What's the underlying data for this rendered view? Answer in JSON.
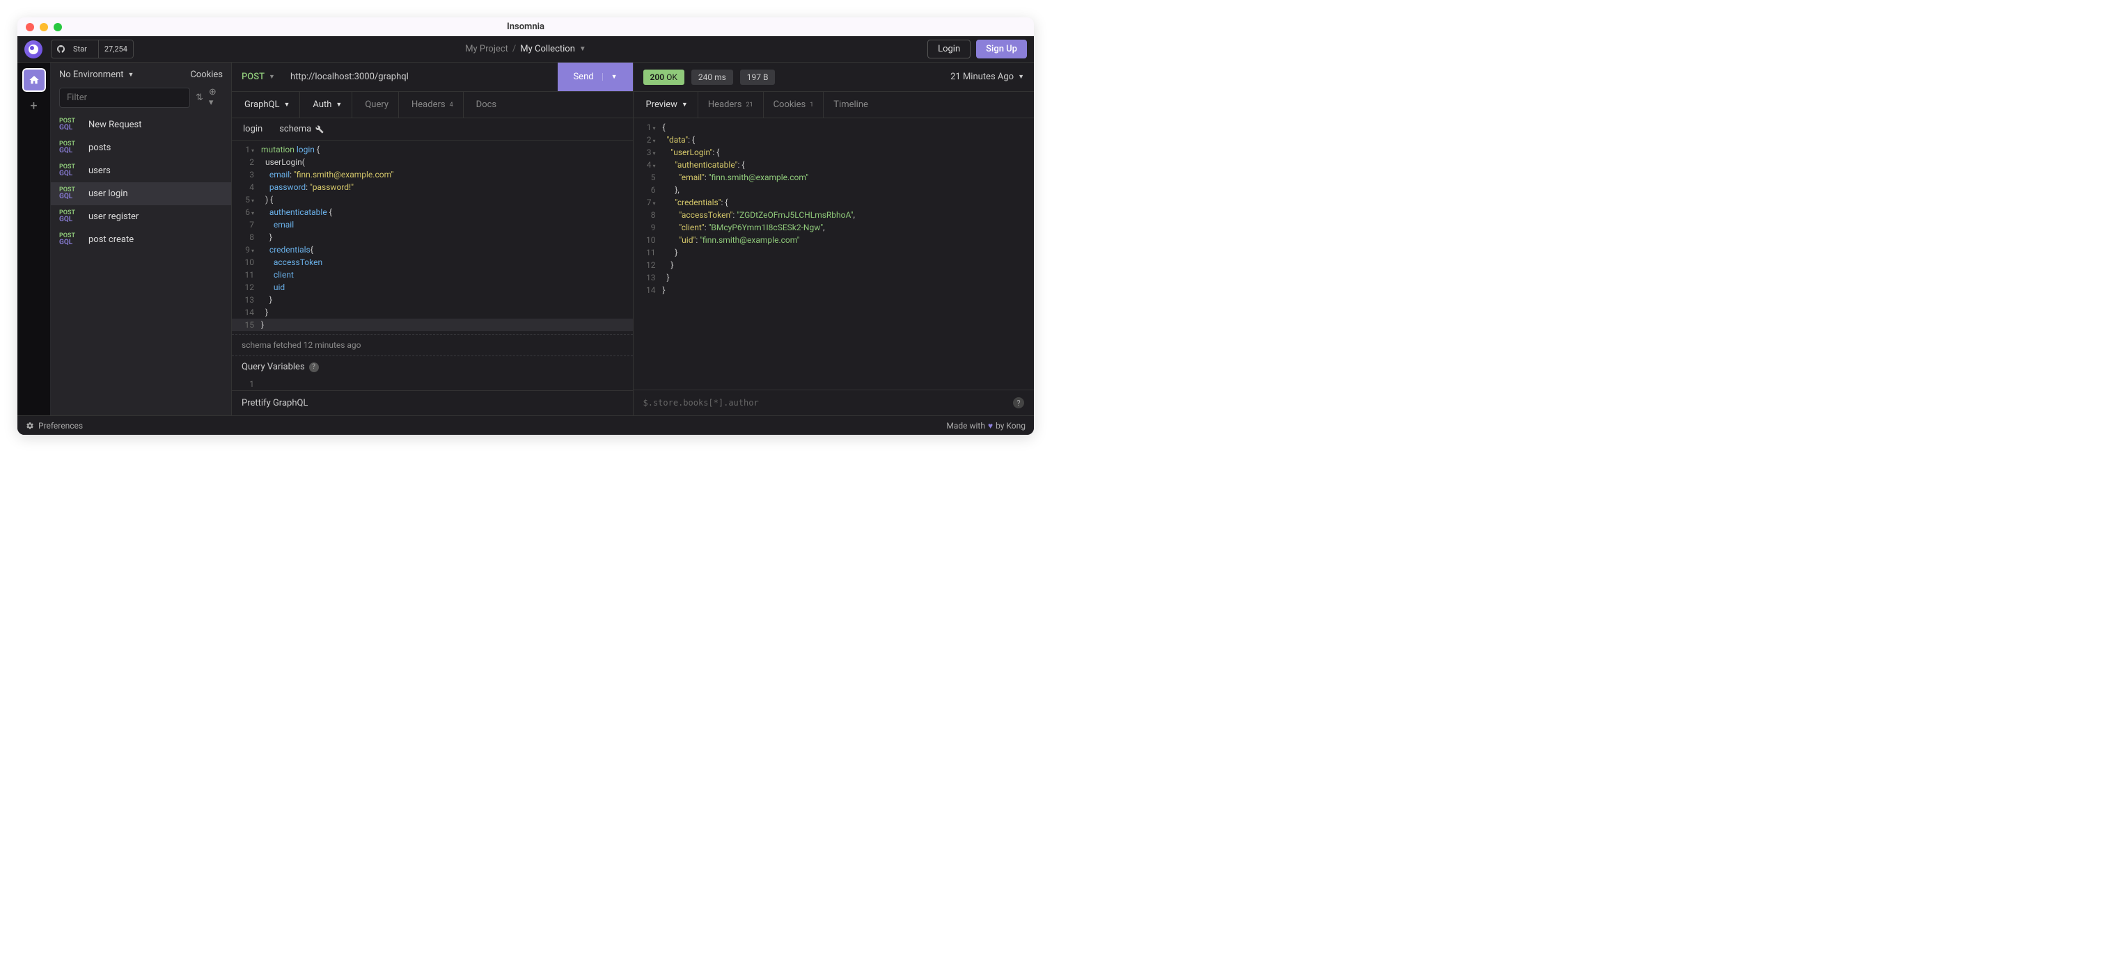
{
  "window": {
    "title": "Insomnia"
  },
  "topbar": {
    "github": {
      "star": "Star",
      "count": "27,254"
    },
    "breadcrumb": {
      "project": "My Project",
      "collection": "My Collection"
    },
    "login": "Login",
    "signup": "Sign Up"
  },
  "sidebar": {
    "env": "No Environment",
    "cookies": "Cookies",
    "filter_placeholder": "Filter",
    "items": [
      {
        "method": "POST",
        "sub": "GQL",
        "label": "New Request"
      },
      {
        "method": "POST",
        "sub": "GQL",
        "label": "posts"
      },
      {
        "method": "POST",
        "sub": "GQL",
        "label": "users"
      },
      {
        "method": "POST",
        "sub": "GQL",
        "label": "user login"
      },
      {
        "method": "POST",
        "sub": "GQL",
        "label": "user register"
      },
      {
        "method": "POST",
        "sub": "GQL",
        "label": "post create"
      }
    ]
  },
  "request": {
    "method": "POST",
    "url": "http://localhost:3000/graphql",
    "send": "Send",
    "tabs": {
      "graphql": "GraphQL",
      "auth": "Auth",
      "query": "Query",
      "headers": "Headers",
      "headers_count": "4",
      "docs": "Docs"
    },
    "subtabs": {
      "login": "login",
      "schema": "schema"
    },
    "schema_status": "schema fetched 12 minutes ago",
    "query_vars": "Query Variables",
    "prettify": "Prettify GraphQL"
  },
  "code": {
    "login_name": "login",
    "email_key": "email",
    "email_val": "\"finn.smith@example.com\"",
    "password_key": "password",
    "password_val": "\"password!\"",
    "userLogin": "userLogin",
    "auth": "authenticatable",
    "cred": "credentials",
    "accessToken": "accessToken",
    "client": "client",
    "uid": "uid"
  },
  "response": {
    "status_code": "200",
    "status_text": "OK",
    "time": "240 ms",
    "size": "197 B",
    "age": "21 Minutes Ago",
    "tabs": {
      "preview": "Preview",
      "headers": "Headers",
      "headers_count": "21",
      "cookies": "Cookies",
      "cookies_count": "1",
      "timeline": "Timeline"
    },
    "filter_placeholder": "$.store.books[*].author"
  },
  "resp_json": {
    "data": "\"data\"",
    "userLogin": "\"userLogin\"",
    "auth": "\"authenticatable\"",
    "email_k": "\"email\"",
    "email_v": "\"finn.smith@example.com\"",
    "cred": "\"credentials\"",
    "at_k": "\"accessToken\"",
    "at_v": "\"ZGDtZeOFmJ5LCHLmsRbhoA\"",
    "client_k": "\"client\"",
    "client_v": "\"BMcyP6Ymm1I8cSESk2-Ngw\"",
    "uid_k": "\"uid\"",
    "uid_v": "\"finn.smith@example.com\""
  },
  "statusbar": {
    "prefs": "Preferences",
    "made": "Made with",
    "kong": "by Kong"
  }
}
